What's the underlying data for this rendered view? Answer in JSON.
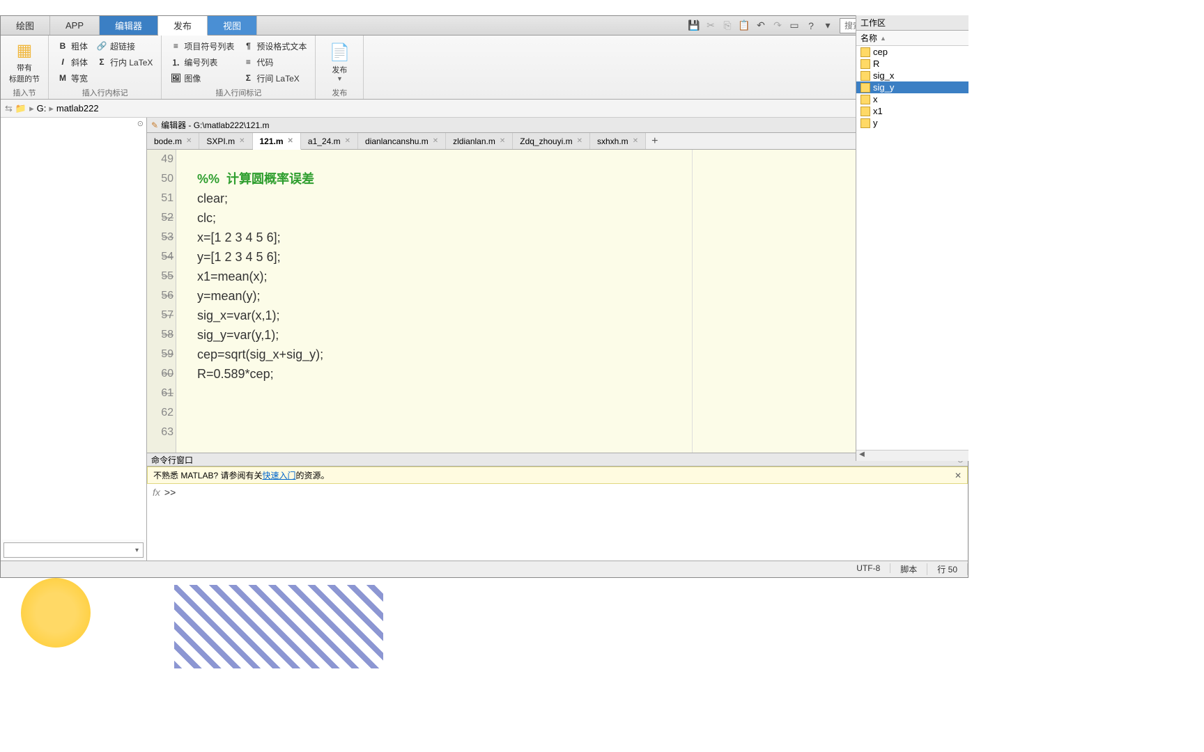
{
  "menuTabs": {
    "plot": "绘图",
    "app": "APP",
    "editor": "编辑器",
    "publish": "发布",
    "view": "视图"
  },
  "searchPlaceholder": "搜索文档",
  "ribbon": {
    "section": {
      "btn": "带有\n标题的节",
      "label": "插入节"
    },
    "format": {
      "bold": "粗体",
      "italic": "斜体",
      "mono": "等宽",
      "link": "超链接",
      "inlineLatex": "行内 LaTeX",
      "label": "插入行内标记"
    },
    "insert": {
      "bulletList": "项目符号列表",
      "numList": "编号列表",
      "image": "图像",
      "preformat": "预设格式文本",
      "code": "代码",
      "lineLatex": "行间 LaTeX",
      "label": "插入行间标记"
    },
    "publish": {
      "btn": "发布",
      "label": "发布"
    }
  },
  "path": {
    "drive": "G:",
    "folder": "matlab222"
  },
  "editor": {
    "title": "编辑器 - G:\\matlab222\\121.m",
    "tabs": [
      "bode.m",
      "SXPI.m",
      "121.m",
      "a1_24.m",
      "dianlancanshu.m",
      "zldianlan.m",
      "Zdq_zhouyi.m",
      "sxhxh.m"
    ],
    "activeTab": "121.m",
    "addTab": "+",
    "lines": [
      {
        "num": "49",
        "mark": "",
        "text": ""
      },
      {
        "num": "50",
        "mark": "",
        "text": "%%  计算圆概率误差",
        "cls": "comment"
      },
      {
        "num": "51",
        "mark": "—",
        "text": "clear;"
      },
      {
        "num": "52",
        "mark": "—",
        "text": "clc;"
      },
      {
        "num": "53",
        "mark": "—",
        "text": "x=[1 2 3 4 5 6];"
      },
      {
        "num": "54",
        "mark": "—",
        "text": "y=[1 2 3 4 5 6];"
      },
      {
        "num": "55",
        "mark": "—",
        "text": "x1=mean(x);"
      },
      {
        "num": "56",
        "mark": "—",
        "text": "y=mean(y);"
      },
      {
        "num": "57",
        "mark": "—",
        "text": "sig_x=var(x,1);"
      },
      {
        "num": "58",
        "mark": "—",
        "text": "sig_y=var(y,1);"
      },
      {
        "num": "59",
        "mark": "—",
        "text": "cep=sqrt(sig_x+sig_y);"
      },
      {
        "num": "60",
        "mark": "—",
        "text": "R=0.589*cep;"
      },
      {
        "num": "61",
        "mark": "",
        "text": ""
      },
      {
        "num": "62",
        "mark": "",
        "text": ""
      },
      {
        "num": "63",
        "mark": "",
        "text": ""
      }
    ]
  },
  "command": {
    "title": "命令行窗口",
    "hintPre": "不熟悉 MATLAB? 请参阅有关",
    "hintLink": "快速入门",
    "hintPost": "的资源。",
    "fx": "fx",
    "prompt": ">>"
  },
  "workspace": {
    "title": "工作区",
    "colName": "名称",
    "vars": [
      "cep",
      "R",
      "sig_x",
      "sig_y",
      "x",
      "x1",
      "y"
    ],
    "selected": "sig_y"
  },
  "status": {
    "encoding": "UTF-8",
    "type": "脚本",
    "lineLabel": "行",
    "lineNum": "50"
  }
}
